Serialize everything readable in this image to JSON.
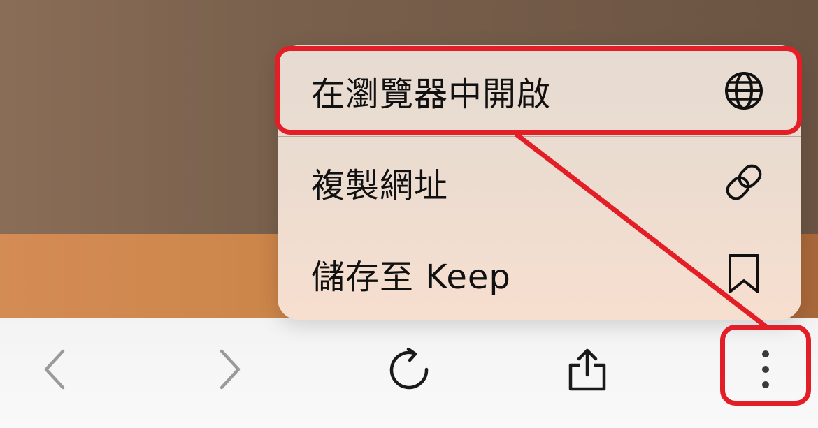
{
  "menu": {
    "items": [
      {
        "label": "在瀏覽器中開啟",
        "icon": "globe-icon"
      },
      {
        "label": "複製網址",
        "icon": "link-icon"
      },
      {
        "label": "儲存至 Keep",
        "icon": "bookmark-icon"
      }
    ]
  },
  "toolbar": {
    "buttons": [
      {
        "icon": "back-icon"
      },
      {
        "icon": "forward-icon"
      },
      {
        "icon": "reload-icon"
      },
      {
        "icon": "share-icon"
      },
      {
        "icon": "more-vertical-icon"
      }
    ]
  },
  "colors": {
    "annotation_red": "#e41e26",
    "menu_text": "#111111",
    "toolbar_icon": "#1a1a1a",
    "toolbar_icon_disabled": "#9a9a9a"
  }
}
